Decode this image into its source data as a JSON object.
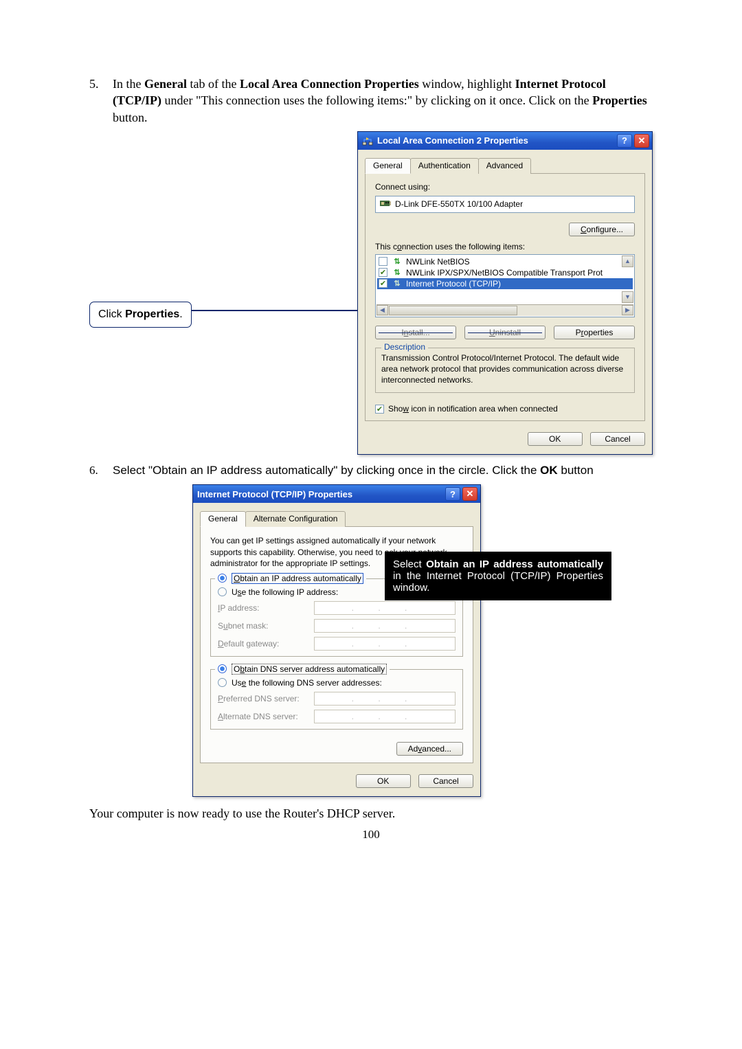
{
  "step5": {
    "num": "5.",
    "text_pre": "In the ",
    "bold1": "General",
    "t2": " tab of the ",
    "bold2": "Local Area Connection Properties",
    "t3": " window, highlight ",
    "bold3": "Internet Protocol (TCP/IP)",
    "t4": " under \"This connection uses the following items:\" by clicking on it once. Click on the ",
    "bold4": "Properties",
    "t5": " button."
  },
  "callout1": {
    "pre": "Click ",
    "bold": "Properties",
    "post": "."
  },
  "dialog1": {
    "title": "Local Area Connection 2 Properties",
    "tabs": {
      "general": "General",
      "auth": "Authentication",
      "adv": "Advanced"
    },
    "connect_using": "Connect using:",
    "adapter": "D-Link DFE-550TX 10/100 Adapter",
    "configure": "Configure...",
    "configure_accel": "C",
    "items_label": "This connection uses the following items:",
    "items_label_accel": "o",
    "list": {
      "netbios": "NWLink NetBIOS",
      "ipxspx": "NWLink IPX/SPX/NetBIOS Compatible Transport Prot",
      "tcpip": "Internet Protocol (TCP/IP)"
    },
    "install": "Install...",
    "install_accel": "n",
    "uninstall": "Uninstall",
    "uninstall_accel": "U",
    "properties": "Properties",
    "properties_accel": "r",
    "desc_legend": "Description",
    "desc_text": "Transmission Control Protocol/Internet Protocol. The default wide area network protocol that provides communication across diverse interconnected networks.",
    "show_icon": "Show icon in notification area when connected",
    "show_icon_accel": "w",
    "ok": "OK",
    "cancel": "Cancel"
  },
  "step6": {
    "num": "6.",
    "t1": "Select \"Obtain an IP address automatically\" by clicking once in the circle. Click the ",
    "bold1": "OK",
    "t2": " button"
  },
  "dialog2": {
    "title": "Internet Protocol (TCP/IP) Properties",
    "tabs": {
      "general": "General",
      "alt": "Alternate Configuration"
    },
    "intro": "You can get IP settings assigned automatically if your network supports this capability. Otherwise, you need to ask your network administrator for the appropriate IP settings.",
    "obtain_ip": "Obtain an IP address automatically",
    "obtain_ip_accel": "O",
    "use_ip": "Use the following IP address:",
    "use_ip_accel": "s",
    "ip_addr": "IP address:",
    "subnet": "Subnet mask:",
    "gateway": "Default gateway:",
    "obtain_dns": "Obtain DNS server address automatically",
    "obtain_dns_accel": "b",
    "use_dns": "Use the following DNS server addresses:",
    "use_dns_accel": "e",
    "pref_dns": "Preferred DNS server:",
    "alt_dns": "Alternate DNS server:",
    "advanced": "Advanced...",
    "advanced_accel": "v",
    "ok": "OK",
    "cancel": "Cancel"
  },
  "overlay2": {
    "text": "Select Obtain an IP address automatically in the Internet Protocol (TCP/IP) Properties window.",
    "bold_phrase": "Obtain an IP address automatically"
  },
  "closing": "Your computer is now ready to use the Router's DHCP server.",
  "page_num": "100"
}
